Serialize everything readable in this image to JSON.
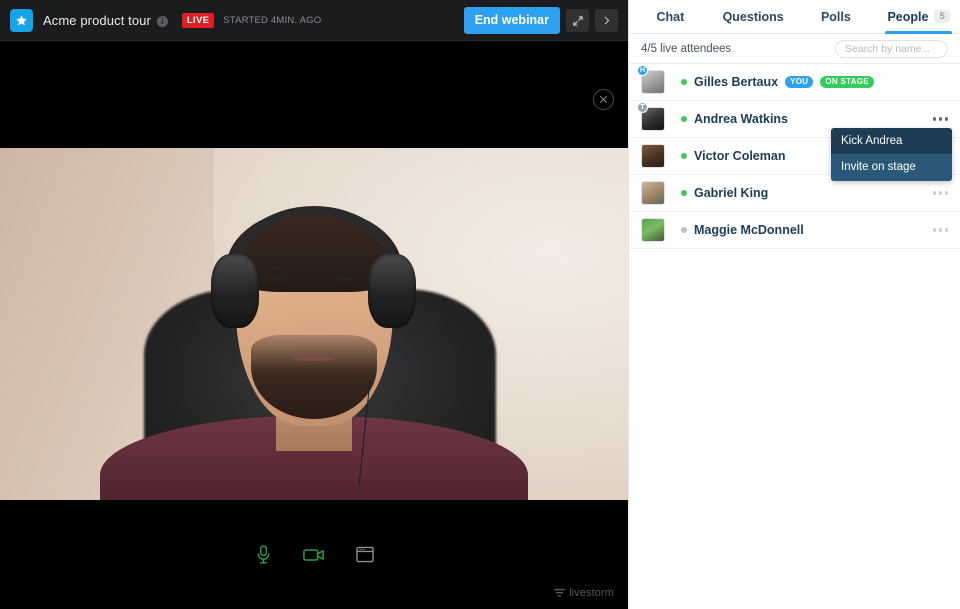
{
  "header": {
    "logo_icon": "star-icon",
    "title": "Acme product tour",
    "info_icon": "info-icon",
    "live_label": "LIVE",
    "started_text": "STARTED 4MIN. AGO",
    "end_button": "End webinar",
    "expand_icon": "expand-arrows-icon",
    "collapse_icon": "chevron-right-icon",
    "accent": "#2da1f0",
    "live_color": "#e01e23"
  },
  "stage": {
    "close_icon": "close-icon",
    "controls": [
      {
        "name": "microphone-button",
        "icon": "microphone-icon",
        "state": "on",
        "color": "#22a14b"
      },
      {
        "name": "camera-button",
        "icon": "video-camera-icon",
        "state": "on",
        "color": "#22a14b"
      },
      {
        "name": "screenshare-button",
        "icon": "screen-share-icon",
        "state": "off",
        "color": "#8b8e92"
      }
    ],
    "brand": "livestorm",
    "brand_icon": "livestorm-logo-icon"
  },
  "panel": {
    "tabs": [
      {
        "label": "Chat",
        "active": false,
        "count": null
      },
      {
        "label": "Questions",
        "active": false,
        "count": null
      },
      {
        "label": "Polls",
        "active": false,
        "count": null
      },
      {
        "label": "People",
        "active": true,
        "count": "5"
      }
    ],
    "attendee_count": "4/5 live attendees",
    "search_placeholder": "Search by name...",
    "search_value": "",
    "people": [
      {
        "name": "Gilles Bertaux",
        "status": "online",
        "role_badge": "H",
        "role_badge_type": "host",
        "pills": [
          {
            "label": "YOU",
            "type": "you"
          },
          {
            "label": "ON STAGE",
            "type": "stage"
          }
        ],
        "has_menu": false
      },
      {
        "name": "Andrea Watkins",
        "status": "online",
        "role_badge": "T",
        "role_badge_type": "team",
        "pills": [],
        "has_menu": true,
        "menu_open": true
      },
      {
        "name": "Victor Coleman",
        "status": "online",
        "role_badge": null,
        "pills": [],
        "has_menu": true
      },
      {
        "name": "Gabriel King",
        "status": "online",
        "role_badge": null,
        "pills": [],
        "has_menu": true
      },
      {
        "name": "Maggie McDonnell",
        "status": "offline",
        "role_badge": null,
        "pills": [],
        "has_menu": true
      }
    ],
    "context_menu": {
      "items": [
        {
          "label": "Kick Andrea",
          "highlight": false
        },
        {
          "label": "Invite on stage",
          "highlight": true
        }
      ]
    }
  }
}
